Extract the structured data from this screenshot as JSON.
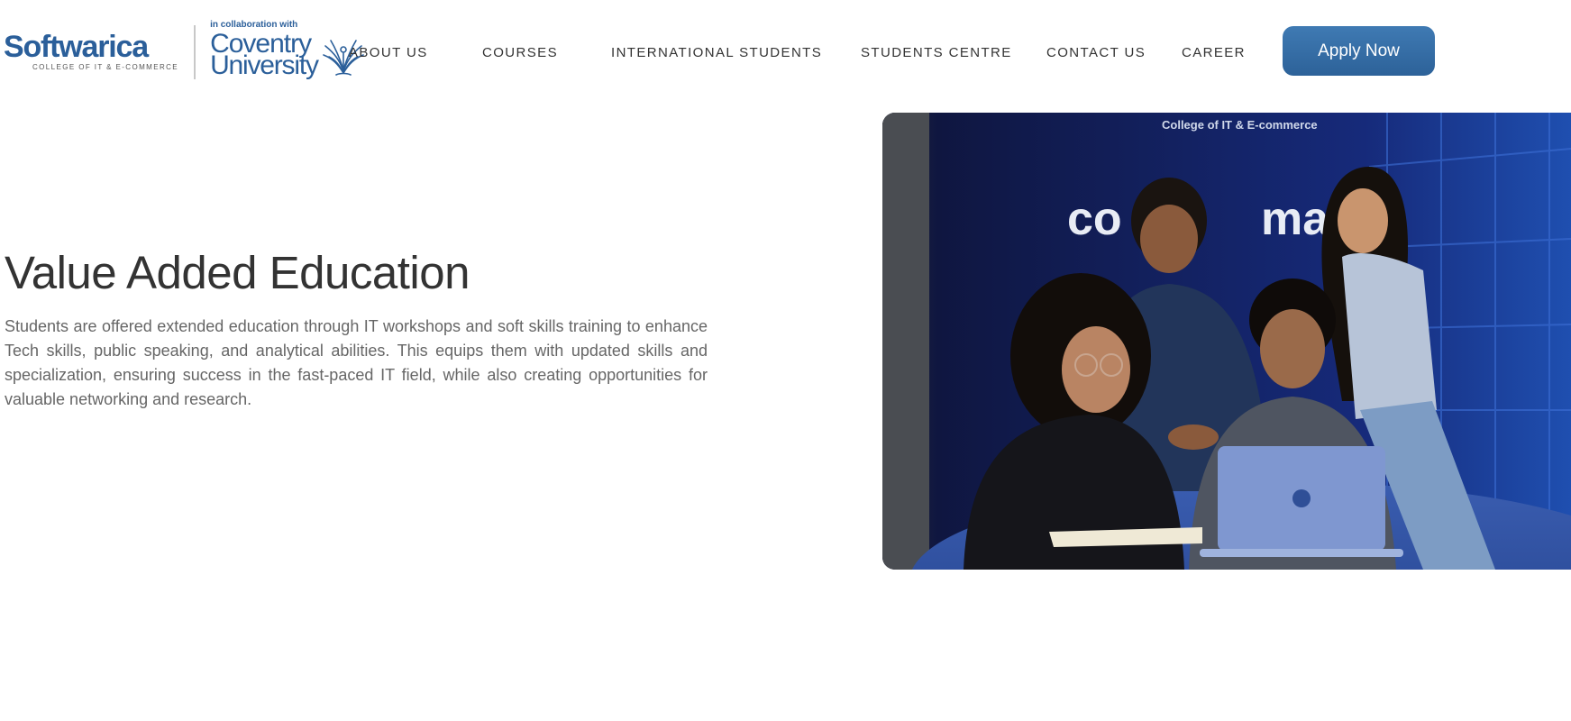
{
  "header": {
    "logo": {
      "brand": "Softwarica",
      "tagline": "COLLEGE OF IT & E-COMMERCE",
      "collab": "in collaboration with",
      "partner_line1": "Coventry",
      "partner_line2": "University",
      "partner_icon": "phoenix-icon"
    },
    "nav": [
      {
        "label": "ABOUT US"
      },
      {
        "label": "COURSES"
      },
      {
        "label": "INTERNATIONAL STUDENTS"
      },
      {
        "label": "STUDENTS CENTRE"
      },
      {
        "label": "CONTACT US"
      },
      {
        "label": "CAREER"
      }
    ],
    "apply_label": "Apply Now"
  },
  "hero": {
    "title": "Value Added Education",
    "text": "Students are offered extended education through IT workshops and soft skills training to enhance Tech skills, public speaking, and analytical abilities. This equips them with updated skills and specialization, ensuring success in the fast-paced IT field, while also creating opportunities for valuable networking and research."
  },
  "colors": {
    "brand_blue": "#2b5f9a",
    "button_blue": "#3672aa",
    "text_dark": "#333333",
    "text_body": "#666666"
  }
}
